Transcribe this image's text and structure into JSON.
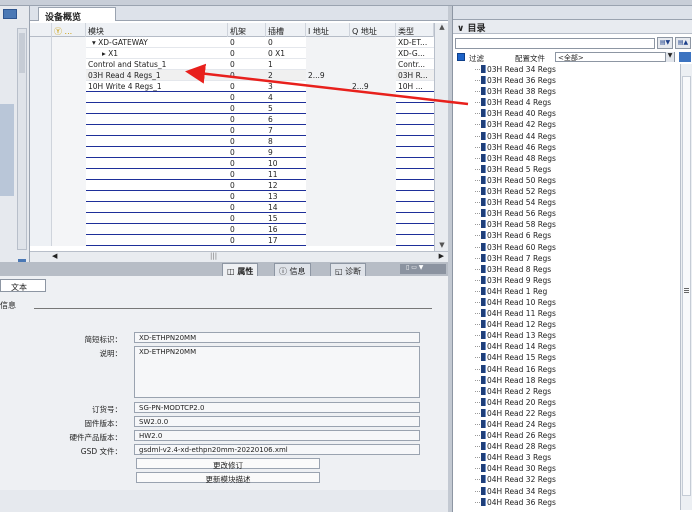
{
  "overview": {
    "tab_label": "设备概览",
    "columns": [
      "模块",
      "机架",
      "插槽",
      "I 地址",
      "Q 地址",
      "类型"
    ],
    "rows": [
      {
        "module": "▾  XD-GATEWAY",
        "rack": "0",
        "slot": "0",
        "i_addr": "",
        "q_addr": "",
        "type": "XD-ET..."
      },
      {
        "module": "▸  X1",
        "rack": "0",
        "slot": "0 X1",
        "i_addr": "",
        "q_addr": "",
        "type": "XD-G..."
      },
      {
        "module": "Control and Status_1",
        "rack": "0",
        "slot": "1",
        "i_addr": "",
        "q_addr": "",
        "type": "Contr..."
      },
      {
        "module": "03H Read 4 Regs_1",
        "rack": "0",
        "slot": "2",
        "i_addr": "2...9",
        "q_addr": "",
        "type": "03H R..."
      },
      {
        "module": "10H Write 4 Regs_1",
        "rack": "0",
        "slot": "3",
        "i_addr": "",
        "q_addr": "2...9",
        "type": "10H ..."
      },
      {
        "module": "",
        "rack": "0",
        "slot": "4",
        "i_addr": "",
        "q_addr": "",
        "type": ""
      },
      {
        "module": "",
        "rack": "0",
        "slot": "5",
        "i_addr": "",
        "q_addr": "",
        "type": ""
      },
      {
        "module": "",
        "rack": "0",
        "slot": "6",
        "i_addr": "",
        "q_addr": "",
        "type": ""
      },
      {
        "module": "",
        "rack": "0",
        "slot": "7",
        "i_addr": "",
        "q_addr": "",
        "type": ""
      },
      {
        "module": "",
        "rack": "0",
        "slot": "8",
        "i_addr": "",
        "q_addr": "",
        "type": ""
      },
      {
        "module": "",
        "rack": "0",
        "slot": "9",
        "i_addr": "",
        "q_addr": "",
        "type": ""
      },
      {
        "module": "",
        "rack": "0",
        "slot": "10",
        "i_addr": "",
        "q_addr": "",
        "type": ""
      },
      {
        "module": "",
        "rack": "0",
        "slot": "11",
        "i_addr": "",
        "q_addr": "",
        "type": ""
      },
      {
        "module": "",
        "rack": "0",
        "slot": "12",
        "i_addr": "",
        "q_addr": "",
        "type": ""
      },
      {
        "module": "",
        "rack": "0",
        "slot": "13",
        "i_addr": "",
        "q_addr": "",
        "type": ""
      },
      {
        "module": "",
        "rack": "0",
        "slot": "14",
        "i_addr": "",
        "q_addr": "",
        "type": ""
      },
      {
        "module": "",
        "rack": "0",
        "slot": "15",
        "i_addr": "",
        "q_addr": "",
        "type": ""
      },
      {
        "module": "",
        "rack": "0",
        "slot": "16",
        "i_addr": "",
        "q_addr": "",
        "type": ""
      },
      {
        "module": "",
        "rack": "0",
        "slot": "17",
        "i_addr": "",
        "q_addr": "",
        "type": ""
      }
    ]
  },
  "props_tabs": {
    "properties": "属性",
    "info": "信息",
    "diagnostics": "诊断",
    "text_tab": "文本",
    "info_section": "信息"
  },
  "props": {
    "short_id_label": "简短标识：",
    "short_id": "XD-ETHPN20MM",
    "desc_label": "说明：",
    "desc": "XD-ETHPN20MM",
    "order_label": "订货号：",
    "order": "SG-PN-MODTCP2.0",
    "fw_label": "固件版本：",
    "fw": "SW2.0.0",
    "hw_label": "硬件产品版本：",
    "hw": "HW2.0",
    "gsd_label": "GSD 文件：",
    "gsd": "gsdml-v2.4-xd-ethpn20mm-20220106.xml",
    "btn_change": "更改修订",
    "btn_update": "更新模块描述"
  },
  "catalog": {
    "title": "目录",
    "filter_label": "过滤",
    "profile_label": "配置文件",
    "profile_value": "<全部>",
    "items": [
      "03H Read 34 Regs",
      "03H Read 36 Regs",
      "03H Read 38 Regs",
      "03H Read 4 Regs",
      "03H Read 40 Regs",
      "03H Read 42 Regs",
      "03H Read 44 Regs",
      "03H Read 46 Regs",
      "03H Read 48 Regs",
      "03H Read 5 Regs",
      "03H Read 50 Regs",
      "03H Read 52 Regs",
      "03H Read 54 Regs",
      "03H Read 56 Regs",
      "03H Read 58 Regs",
      "03H Read 6 Regs",
      "03H Read 60 Regs",
      "03H Read 7 Regs",
      "03H Read 8 Regs",
      "03H Read 9 Regs",
      "04H Read 1 Reg",
      "04H Read 10 Regs",
      "04H Read 11 Regs",
      "04H Read 12 Regs",
      "04H Read 13 Regs",
      "04H Read 14 Regs",
      "04H Read 15 Regs",
      "04H Read 16 Regs",
      "04H Read 18 Regs",
      "04H Read 2 Regs",
      "04H Read 20 Regs",
      "04H Read 22 Regs",
      "04H Read 24 Regs",
      "04H Read 26 Regs",
      "04H Read 28 Regs",
      "04H Read 3 Regs",
      "04H Read 30 Regs",
      "04H Read 32 Regs",
      "04H Read 34 Regs",
      "04H Read 36 Regs"
    ]
  },
  "colors": {
    "accent_blue": "#1e2f9a",
    "arrow_red": "#e8201c"
  }
}
